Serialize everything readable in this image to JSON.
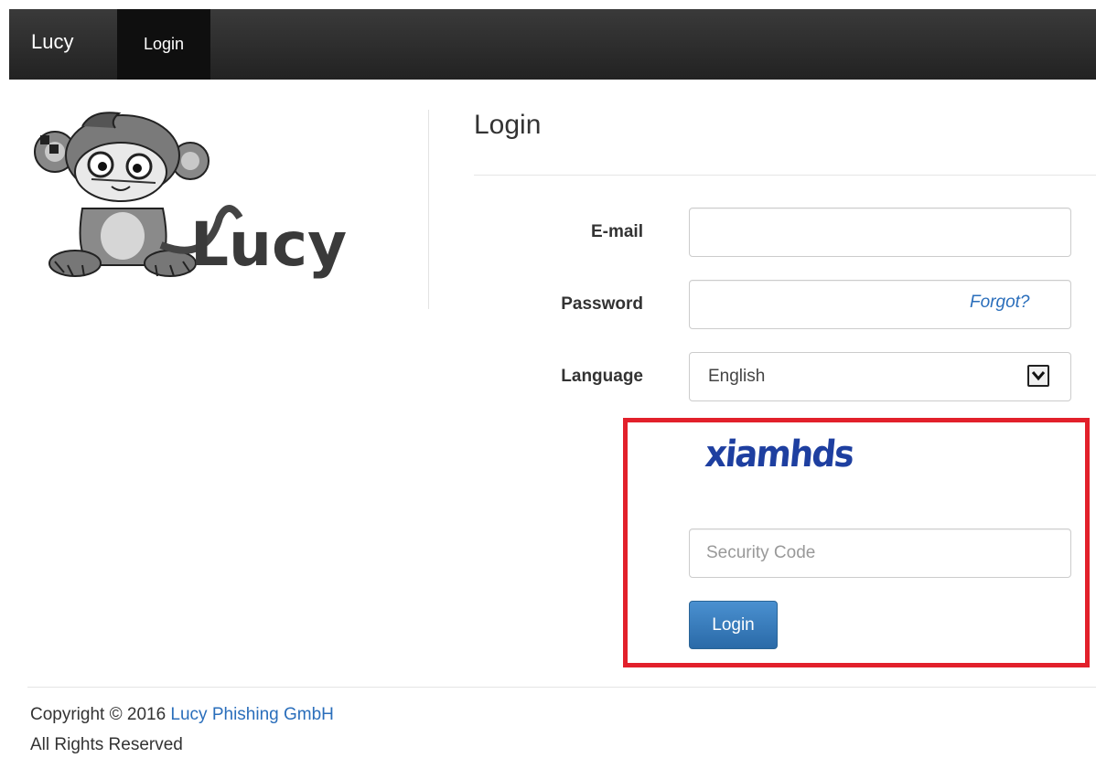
{
  "navbar": {
    "brand": "Lucy",
    "login_link": "Login"
  },
  "logo": {
    "text": "Lucy"
  },
  "form": {
    "title": "Login",
    "email_label": "E-mail",
    "email_value": "",
    "password_label": "Password",
    "password_value": "",
    "forgot_link": "Forgot?",
    "language_label": "Language",
    "language_value": "English",
    "captcha_text": "xiamhds",
    "security_code_placeholder": "Security Code",
    "submit_label": "Login"
  },
  "footer": {
    "copyright_prefix": "Copyright © 2016",
    "company_link": "Lucy Phishing GmbH",
    "rights": "All Rights Reserved"
  },
  "colors": {
    "navbar_bg": "#2b2b2b",
    "link": "#2a6ebb",
    "primary_button": "#337ab7",
    "highlight_border": "#e2202b",
    "captcha": "#1e3fa0"
  }
}
